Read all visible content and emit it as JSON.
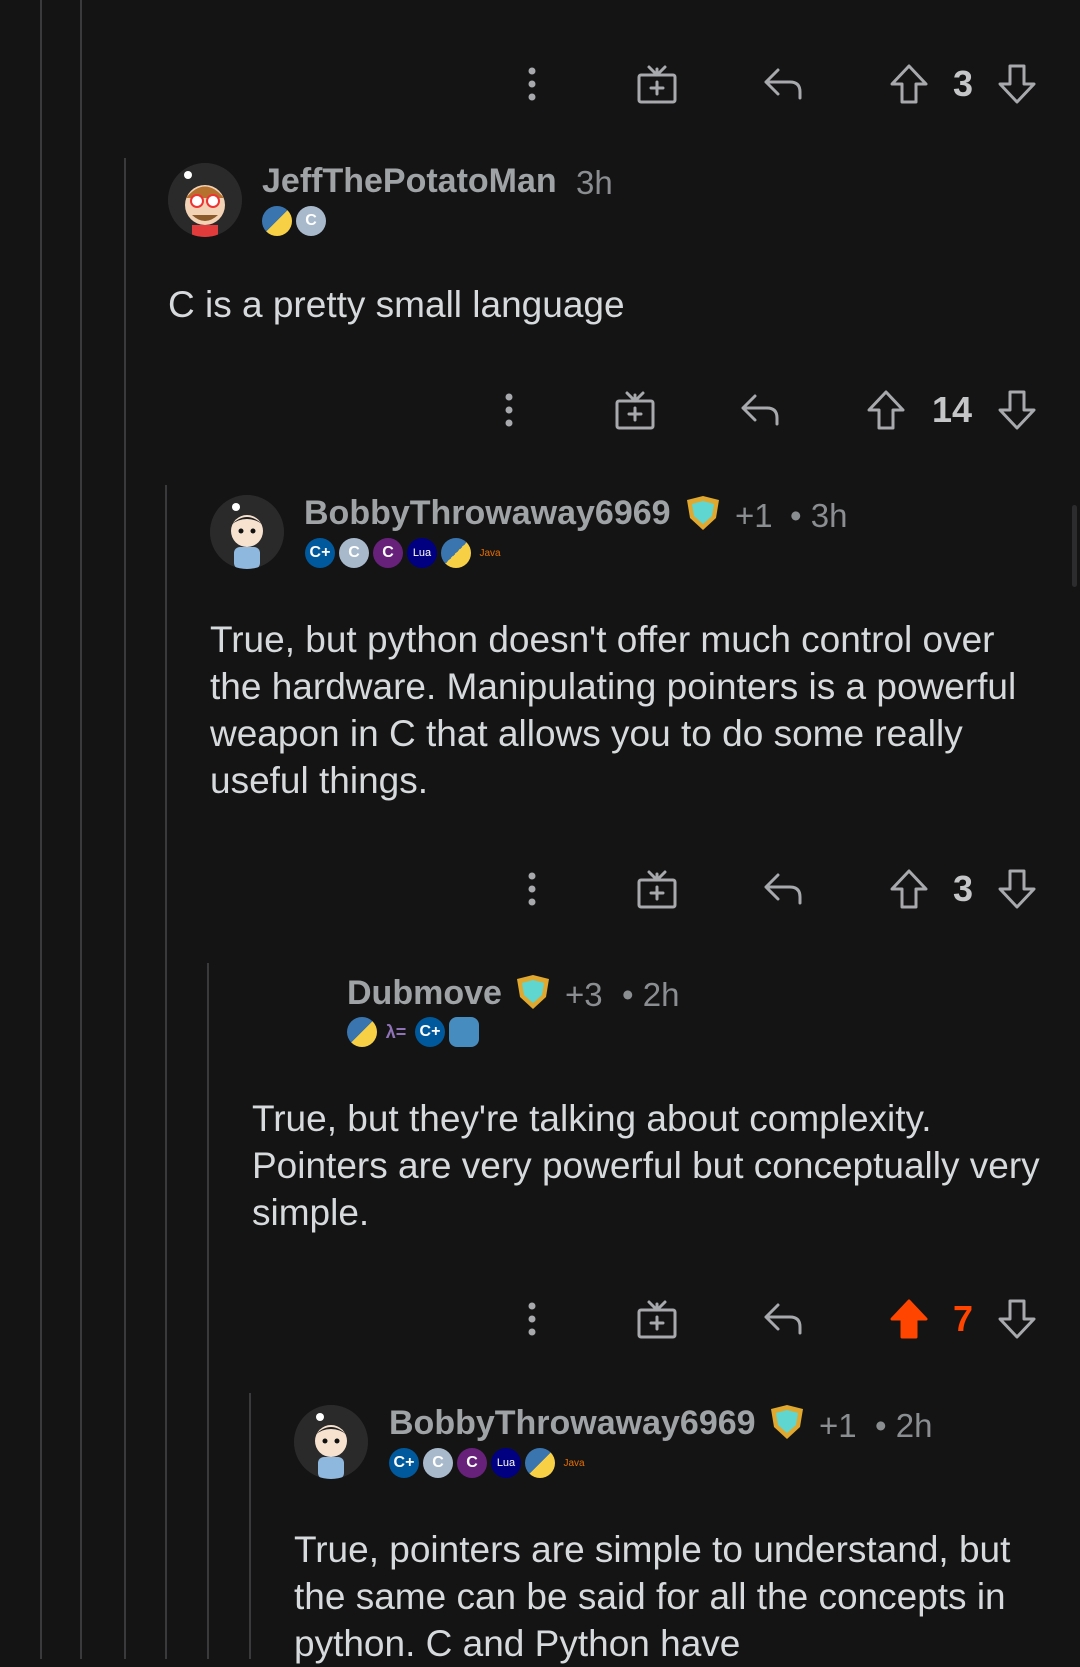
{
  "comments": [
    {
      "actions": {
        "score": "3",
        "voted": false
      }
    },
    {
      "username": "JeffThePotatoMan",
      "time": "3h",
      "flairs": [
        {
          "icon": "python-icon",
          "label": ""
        },
        {
          "icon": "c-icon",
          "label": "C"
        }
      ],
      "body": "C is a pretty small language",
      "actions": {
        "score": "14",
        "voted": false
      }
    },
    {
      "username": "BobbyThrowaway6969",
      "award_count": "+1",
      "time": "• 3h",
      "flairs": [
        {
          "icon": "cpp-icon",
          "label": "C+"
        },
        {
          "icon": "c-icon",
          "label": "C"
        },
        {
          "icon": "csharp-icon",
          "label": "C"
        },
        {
          "icon": "lua-icon",
          "label": "Lua"
        },
        {
          "icon": "python-icon",
          "label": ""
        },
        {
          "icon": "java-icon",
          "label": "Java"
        }
      ],
      "body": "True, but python doesn't offer much control over the hardware. Manipulating pointers is a powerful weapon in C that allows you to do some really useful things.",
      "actions": {
        "score": "3",
        "voted": false
      }
    },
    {
      "username": "Dubmove",
      "award_count": "+3",
      "time": "• 2h",
      "flairs": [
        {
          "icon": "python-icon",
          "label": ""
        },
        {
          "icon": "haskell-icon",
          "label": "λ="
        },
        {
          "icon": "cpp-icon",
          "label": "C+"
        },
        {
          "icon": "godot-icon",
          "label": ""
        }
      ],
      "body": "True, but they're talking about complexity. Pointers are very powerful but conceptually very simple.",
      "actions": {
        "score": "7",
        "voted": true
      }
    },
    {
      "username": "BobbyThrowaway6969",
      "award_count": "+1",
      "time": "• 2h",
      "flairs": [
        {
          "icon": "cpp-icon",
          "label": "C+"
        },
        {
          "icon": "c-icon",
          "label": "C"
        },
        {
          "icon": "csharp-icon",
          "label": "C"
        },
        {
          "icon": "lua-icon",
          "label": "Lua"
        },
        {
          "icon": "python-icon",
          "label": ""
        },
        {
          "icon": "java-icon",
          "label": "Java"
        }
      ],
      "body": "True, pointers are simple to understand, but the same can be said for all the concepts in python. C and Python have"
    }
  ],
  "colors": {
    "background": "#141414",
    "upvote_active": "#ff4500",
    "thread_line": "#3a3a3c",
    "text": "#d7dadc",
    "username": "#a0a3a6"
  }
}
